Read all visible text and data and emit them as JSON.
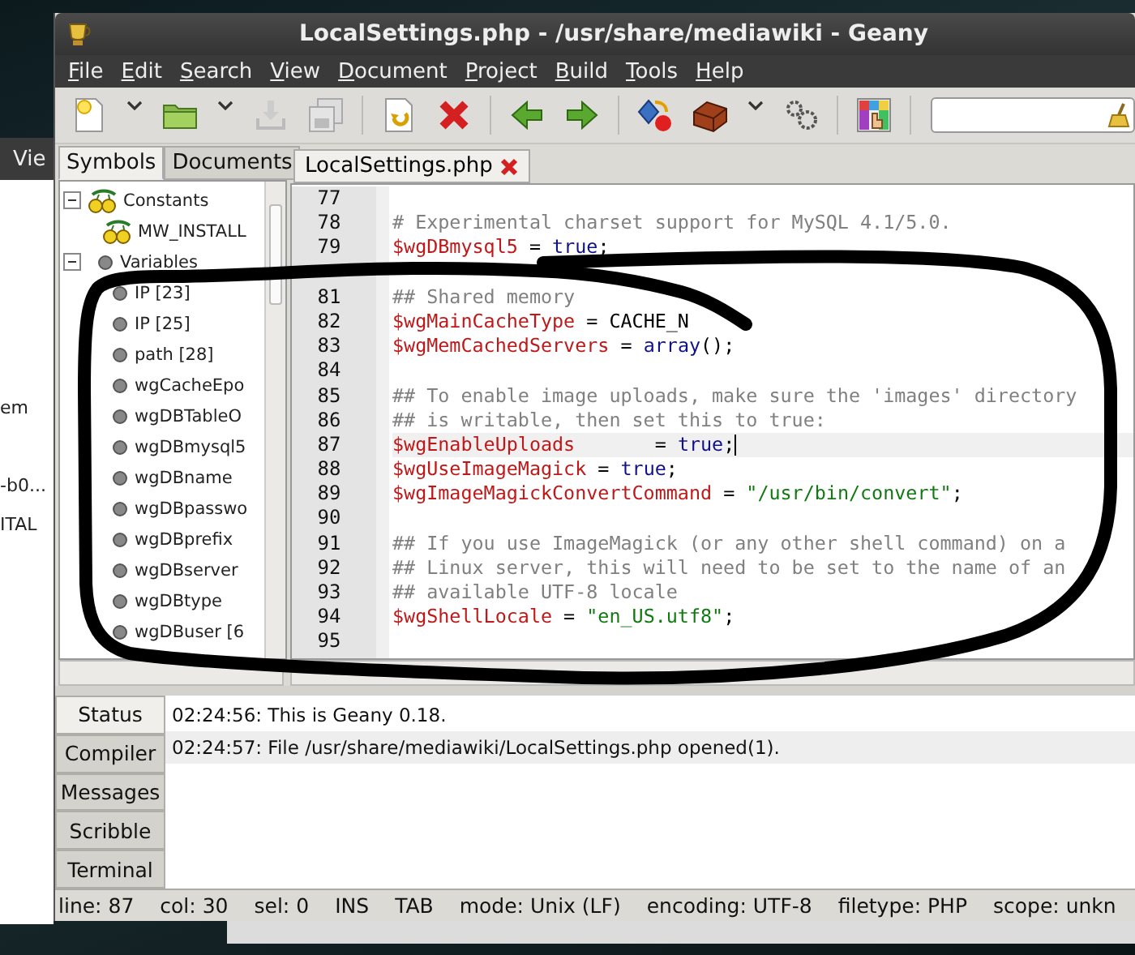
{
  "background_window": {
    "menu_label": "Vie",
    "texts": [
      "em",
      "-b0...",
      "ITAL"
    ]
  },
  "window": {
    "title": "LocalSettings.php - /usr/share/mediawiki - Geany"
  },
  "menu": [
    "File",
    "Edit",
    "Search",
    "View",
    "Document",
    "Project",
    "Build",
    "Tools",
    "Help"
  ],
  "sidebar": {
    "tabs": [
      {
        "label": "Symbols",
        "selected": true
      },
      {
        "label": "Documents",
        "selected": false
      }
    ],
    "tree": [
      {
        "label": "Constants",
        "kind": "constant",
        "expanded": true,
        "children": [
          {
            "label": "MW_INSTALL",
            "kind": "constant"
          }
        ]
      },
      {
        "label": "Variables",
        "kind": "variable",
        "expanded": true,
        "children": [
          {
            "label": "IP [23]",
            "kind": "variable"
          },
          {
            "label": "IP [25]",
            "kind": "variable"
          },
          {
            "label": "path [28]",
            "kind": "variable"
          },
          {
            "label": "wgCacheEpo",
            "kind": "variable"
          },
          {
            "label": "wgDBTableO",
            "kind": "variable"
          },
          {
            "label": "wgDBmysql5",
            "kind": "variable"
          },
          {
            "label": "wgDBname",
            "kind": "variable"
          },
          {
            "label": "wgDBpasswo",
            "kind": "variable"
          },
          {
            "label": "wgDBprefix",
            "kind": "variable"
          },
          {
            "label": "wgDBserver",
            "kind": "variable"
          },
          {
            "label": "wgDBtype",
            "kind": "variable"
          },
          {
            "label": "wgDBuser [6",
            "kind": "variable"
          }
        ]
      }
    ]
  },
  "editor": {
    "tabs": [
      {
        "label": "LocalSettings.php",
        "selected": true
      }
    ],
    "lines": [
      {
        "number": "77",
        "current": false
      },
      {
        "number": "78",
        "current": false,
        "tokens": [
          {
            "kind": "comment",
            "text": "# Experimental charset support for MySQL 4.1/5.0."
          }
        ]
      },
      {
        "number": "79",
        "current": false,
        "tokens": [
          {
            "kind": "variable",
            "text": "$wgDBmysql5"
          },
          {
            "kind": "plain",
            "text": " = "
          },
          {
            "kind": "keyword",
            "text": "true"
          },
          {
            "kind": "plain",
            "text": ";"
          }
        ]
      },
      {
        "current": false
      },
      {
        "number": "81",
        "current": false,
        "tokens": [
          {
            "kind": "comment",
            "text": "## Shared memory"
          }
        ]
      },
      {
        "number": "82",
        "current": false,
        "tokens": [
          {
            "kind": "variable",
            "text": "$wgMainCacheType"
          },
          {
            "kind": "plain",
            "text": " = CACHE_N"
          }
        ]
      },
      {
        "number": "83",
        "current": false,
        "tokens": [
          {
            "kind": "variable",
            "text": "$wgMemCachedServers"
          },
          {
            "kind": "plain",
            "text": " = "
          },
          {
            "kind": "keyword",
            "text": "array"
          },
          {
            "kind": "plain",
            "text": "();"
          }
        ]
      },
      {
        "number": "84",
        "current": false
      },
      {
        "number": "85",
        "current": false,
        "tokens": [
          {
            "kind": "comment",
            "text": "## To enable image uploads, make sure the 'images' directory"
          }
        ]
      },
      {
        "number": "86",
        "current": false,
        "tokens": [
          {
            "kind": "comment",
            "text": "## is writable, then set this to true:"
          }
        ]
      },
      {
        "number": "87",
        "current": true,
        "tokens": [
          {
            "kind": "variable",
            "text": "$wgEnableUploads"
          },
          {
            "kind": "plain",
            "text": "       = "
          },
          {
            "kind": "keyword",
            "text": "true"
          },
          {
            "kind": "plain",
            "text": ";"
          }
        ]
      },
      {
        "number": "88",
        "current": false,
        "tokens": [
          {
            "kind": "variable",
            "text": "$wgUseImageMagick"
          },
          {
            "kind": "plain",
            "text": " = "
          },
          {
            "kind": "keyword",
            "text": "true"
          },
          {
            "kind": "plain",
            "text": ";"
          }
        ]
      },
      {
        "number": "89",
        "current": false,
        "tokens": [
          {
            "kind": "variable",
            "text": "$wgImageMagickConvertCommand"
          },
          {
            "kind": "plain",
            "text": " = "
          },
          {
            "kind": "string",
            "text": "\"/usr/bin/convert\""
          },
          {
            "kind": "plain",
            "text": ";"
          }
        ]
      },
      {
        "number": "90",
        "current": false
      },
      {
        "number": "91",
        "current": false,
        "tokens": [
          {
            "kind": "comment",
            "text": "## If you use ImageMagick (or any other shell command) on a"
          }
        ]
      },
      {
        "number": "92",
        "current": false,
        "tokens": [
          {
            "kind": "comment",
            "text": "## Linux server, this will need to be set to the name of an"
          }
        ]
      },
      {
        "number": "93",
        "current": false,
        "tokens": [
          {
            "kind": "comment",
            "text": "## available UTF-8 locale"
          }
        ]
      },
      {
        "number": "94",
        "current": false,
        "tokens": [
          {
            "kind": "variable",
            "text": "$wgShellLocale"
          },
          {
            "kind": "plain",
            "text": " = "
          },
          {
            "kind": "string",
            "text": "\"en_US.utf8\""
          },
          {
            "kind": "plain",
            "text": ";"
          }
        ]
      },
      {
        "number": "95",
        "current": false
      }
    ]
  },
  "messages": {
    "tabs": [
      {
        "label": "Status",
        "selected": true
      },
      {
        "label": "Compiler",
        "selected": false
      },
      {
        "label": "Messages",
        "selected": false
      },
      {
        "label": "Scribble",
        "selected": false
      },
      {
        "label": "Terminal",
        "selected": false
      }
    ],
    "lines": [
      {
        "text": "02:24:56: This is Geany 0.18.",
        "selected": false
      },
      {
        "text": "02:24:57: File /usr/share/mediawiki/LocalSettings.php opened(1).",
        "selected": true
      }
    ]
  },
  "status_bar": [
    "line: 87",
    "col: 30",
    "sel: 0",
    "INS",
    "TAB",
    "mode: Unix (LF)",
    "encoding: UTF-8",
    "filetype: PHP",
    "scope: unkn"
  ]
}
